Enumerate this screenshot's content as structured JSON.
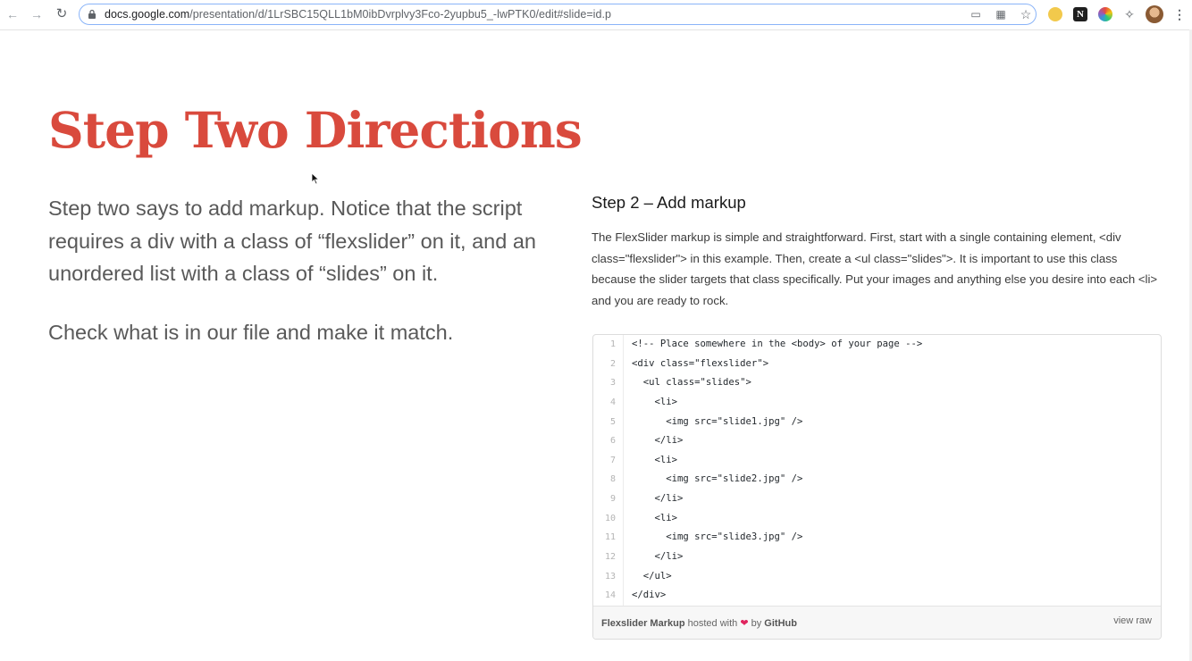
{
  "browser": {
    "url_host": "docs.google.com",
    "url_path": "/presentation/d/1LrSBC15QLL1bM0ibDvrplvy3Fco-2yupbu5_-lwPTK0/edit#slide=id.p",
    "icons": [
      "back-arrow-icon",
      "forward-arrow-icon",
      "reload-icon",
      "lock-icon",
      "cast-icon",
      "apps-icon",
      "star-icon",
      "extension-icon",
      "notion-icon",
      "color-extension-icon",
      "puzzle-icon",
      "avatar",
      "more-menu-icon"
    ]
  },
  "slide": {
    "title": "Step Two Directions",
    "paragraph1": "Step two says to add markup. Notice that the script requires a div with a class of “flexslider” on it, and an unordered list with a class of “slides” on it.",
    "paragraph2": "Check what is in our file and make it match.",
    "accent_color": "#d94a3d",
    "body_color": "#595959"
  },
  "doc": {
    "heading": "Step 2 – Add markup",
    "description": "The FlexSlider markup is simple and straightforward. First, start with a single containing element, <div class=\"flexslider\"> in this example. Then, create a <ul class=\"slides\">. It is important to use this class because the slider targets that class specifically. Put your images and anything else you desire into each <li> and you are ready to rock."
  },
  "gist": {
    "lines": [
      {
        "n": "1",
        "code": "<!-- Place somewhere in the <body> of your page -->"
      },
      {
        "n": "2",
        "code": "<div class=\"flexslider\">"
      },
      {
        "n": "3",
        "code": "  <ul class=\"slides\">"
      },
      {
        "n": "4",
        "code": "    <li>"
      },
      {
        "n": "5",
        "code": "      <img src=\"slide1.jpg\" />"
      },
      {
        "n": "6",
        "code": "    </li>"
      },
      {
        "n": "7",
        "code": "    <li>"
      },
      {
        "n": "8",
        "code": "      <img src=\"slide2.jpg\" />"
      },
      {
        "n": "9",
        "code": "    </li>"
      },
      {
        "n": "10",
        "code": "    <li>"
      },
      {
        "n": "11",
        "code": "      <img src=\"slide3.jpg\" />"
      },
      {
        "n": "12",
        "code": "    </li>"
      },
      {
        "n": "13",
        "code": "  </ul>"
      },
      {
        "n": "14",
        "code": "</div>"
      }
    ],
    "file_name": "Flexslider Markup",
    "hosted_with": "hosted with",
    "by": "by",
    "host_name": "GitHub",
    "view_raw": "view raw"
  }
}
